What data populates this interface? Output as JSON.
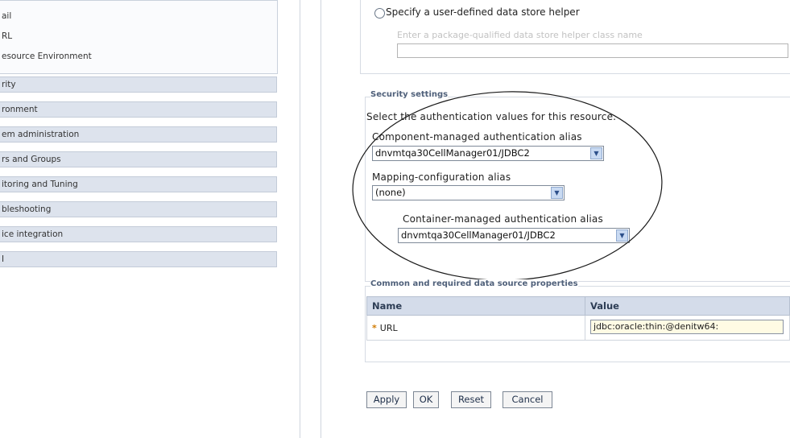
{
  "nav": {
    "sub_items": [
      "ail",
      "RL",
      "esource Environment"
    ],
    "items": [
      "rity",
      "ronment",
      "em administration",
      "rs and Groups",
      "itoring and Tuning",
      "bleshooting",
      "ice integration",
      "I"
    ]
  },
  "helper": {
    "radio_label": "Specify a user-defined data store helper",
    "class_name_label": "Enter a package-qualified data store helper class name"
  },
  "security": {
    "title": "Security settings",
    "instructions": "Select the authentication values for this resource.",
    "component_alias_label": "Component-managed authentication alias",
    "component_alias_value": "dnvmtqa30CellManager01/JDBC2",
    "mapping_label": "Mapping-configuration alias",
    "mapping_value": "(none)",
    "container_alias_label": "Container-managed authentication alias",
    "container_alias_value": "dnvmtqa30CellManager01/JDBC2"
  },
  "properties": {
    "title": "Common and required data source properties",
    "columns": [
      "Name",
      "Value"
    ],
    "rows": [
      {
        "required_marker": "*",
        "name": "URL",
        "value": "jdbc:oracle:thin:@denitw64:"
      }
    ]
  },
  "buttons": {
    "apply": "Apply",
    "ok": "OK",
    "reset": "Reset",
    "cancel": "Cancel"
  },
  "icons": {
    "dropdown": "chevron-down-icon",
    "required": "asterisk-icon"
  }
}
